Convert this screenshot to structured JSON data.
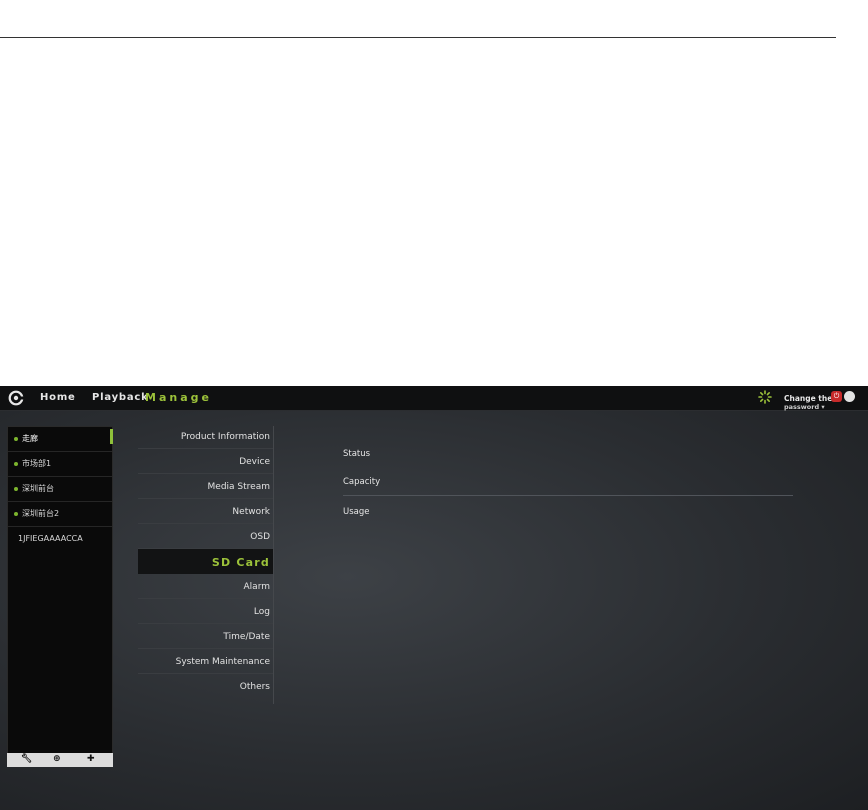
{
  "header": {
    "nav": [
      "Home",
      "Playback",
      "Manage"
    ],
    "active_nav": "Manage",
    "change_password_line1": "Change the",
    "change_password_line2": "password"
  },
  "devices": [
    {
      "label": "走廊",
      "dot": true,
      "selected": true
    },
    {
      "label": "市场部1",
      "dot": true
    },
    {
      "label": "深圳前台",
      "dot": true
    },
    {
      "label": "深圳前台2",
      "dot": true
    },
    {
      "label": "1JFIEGAAAACCA",
      "dot": false
    }
  ],
  "device_tools": [
    "wrench-icon",
    "zoom-icon",
    "add-icon"
  ],
  "menu": [
    "Product Information",
    "Device",
    "Media Stream",
    "Network",
    "OSD",
    "SD Card",
    "Alarm",
    "Log",
    "Time/Date",
    "System Maintenance",
    "Others"
  ],
  "active_menu": "SD Card",
  "sd_card": {
    "status_label": "Status",
    "capacity_label": "Capacity",
    "usage_label": "Usage"
  },
  "colors": {
    "accent": "#9cc23a",
    "status_dot": "#7db52e",
    "power": "#c62a2a"
  }
}
